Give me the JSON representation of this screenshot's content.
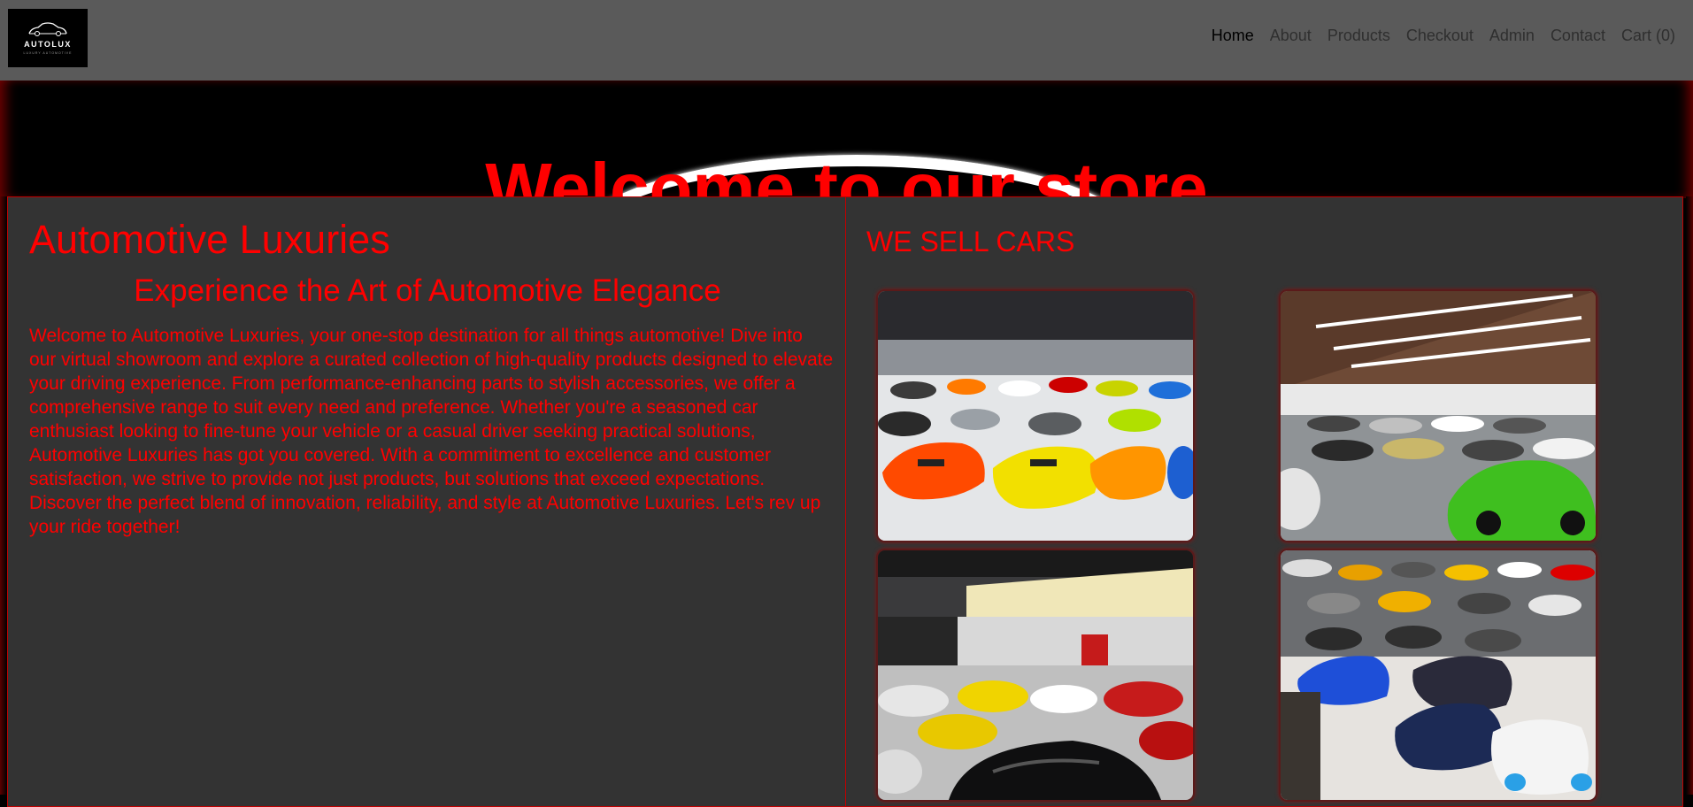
{
  "brand": {
    "logo_word": "AUTOLUX",
    "logo_tagline": "LUXURY AUTOMOTIVE"
  },
  "nav": {
    "items": [
      {
        "label": "Home",
        "active": true
      },
      {
        "label": "About"
      },
      {
        "label": "Products"
      },
      {
        "label": "Checkout"
      },
      {
        "label": "Admin"
      },
      {
        "label": "Contact"
      },
      {
        "label": "Cart (0)"
      }
    ]
  },
  "hero": {
    "title": "Welcome to our store"
  },
  "left_panel": {
    "heading": "Automotive Luxuries",
    "subheading": "Experience the Art of Automotive Elegance",
    "body": "Welcome to Automotive Luxuries, your one-stop destination for all things automotive! Dive into our virtual showroom and explore a curated collection of high-quality products designed to elevate your driving experience. From performance-enhancing parts to stylish accessories, we offer a comprehensive range to suit every need and preference. Whether you're a seasoned car enthusiast looking to fine-tune your vehicle or a casual driver seeking practical solutions, Automotive Luxuries has got you covered. With a commitment to excellence and customer satisfaction, we strive to provide not just products, but solutions that exceed expectations. Discover the perfect blend of innovation, reliability, and style at Automotive Luxuries. Let's rev up your ride together!"
  },
  "right_panel": {
    "heading": "WE SELL CARS",
    "photos": [
      {
        "icon": "showroom-photo-supercars"
      },
      {
        "icon": "showroom-photo-warehouse"
      },
      {
        "icon": "showroom-photo-dealership"
      },
      {
        "icon": "showroom-photo-hypercars"
      }
    ]
  },
  "colors": {
    "accent": "#ff0000",
    "navbar": "#5a5a5a",
    "panel": "#333333",
    "hero": "#000000"
  }
}
